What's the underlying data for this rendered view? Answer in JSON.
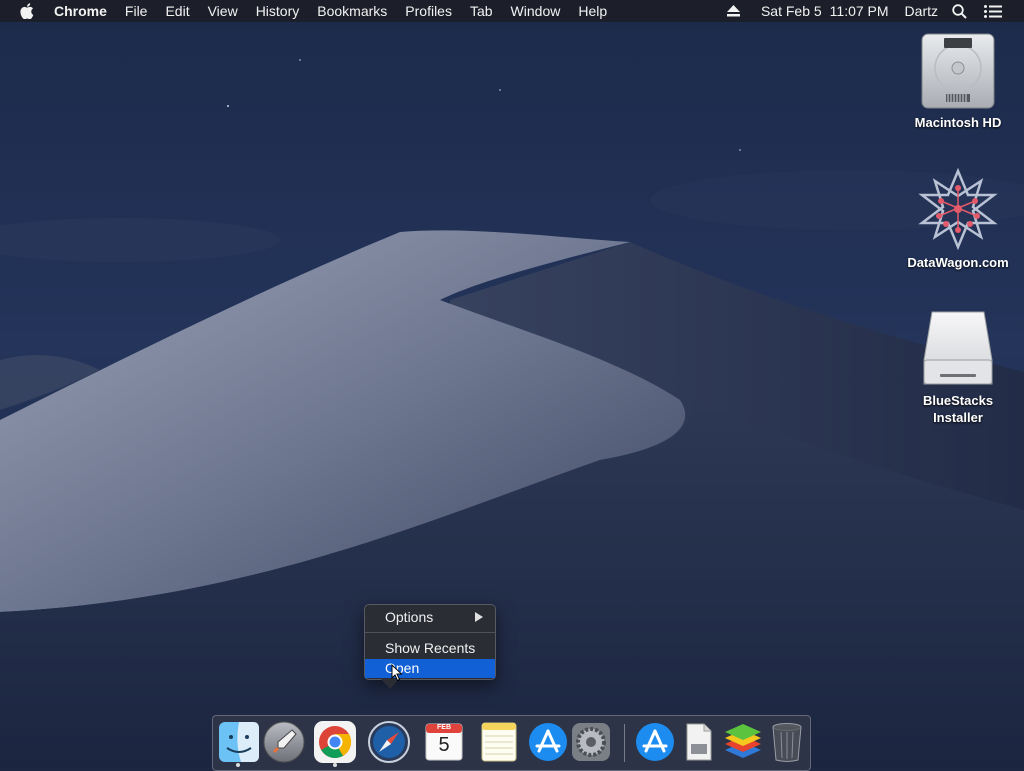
{
  "menubar": {
    "app_name": "Chrome",
    "items": [
      "File",
      "Edit",
      "View",
      "History",
      "Bookmarks",
      "Profiles",
      "Tab",
      "Window",
      "Help"
    ],
    "date": "Sat Feb 5",
    "time": "11:07 PM",
    "user": "Dartz",
    "icons": [
      "apple-logo-icon",
      "eject-icon",
      "search-icon",
      "notification-center-icon"
    ]
  },
  "desktop_icons": [
    {
      "label": "Macintosh HD",
      "icon": "hard-drive-icon"
    },
    {
      "label": "DataWagon.com",
      "icon": "datawagon-logo-icon"
    },
    {
      "label": "BlueStacks\nInstaller",
      "label_line1": "BlueStacks",
      "label_line2": "Installer",
      "icon": "disk-image-icon"
    }
  ],
  "context_menu": {
    "options_label": "Options",
    "show_recents_label": "Show Recents",
    "open_label": "Open"
  },
  "dock": {
    "calendar": {
      "month": "FEB",
      "day": "5"
    },
    "items": [
      "finder-icon",
      "launchpad-icon",
      "chrome-icon",
      "safari-icon",
      "calendar-icon",
      "notes-icon",
      "app-store-icon",
      "system-preferences-icon",
      "downloads-icon",
      "document-icon",
      "bluestacks-icon",
      "trash-icon"
    ]
  },
  "colors": {
    "menu_highlight": "#1160d6",
    "sky": "#1d2742",
    "dune": "#8a92a8"
  }
}
